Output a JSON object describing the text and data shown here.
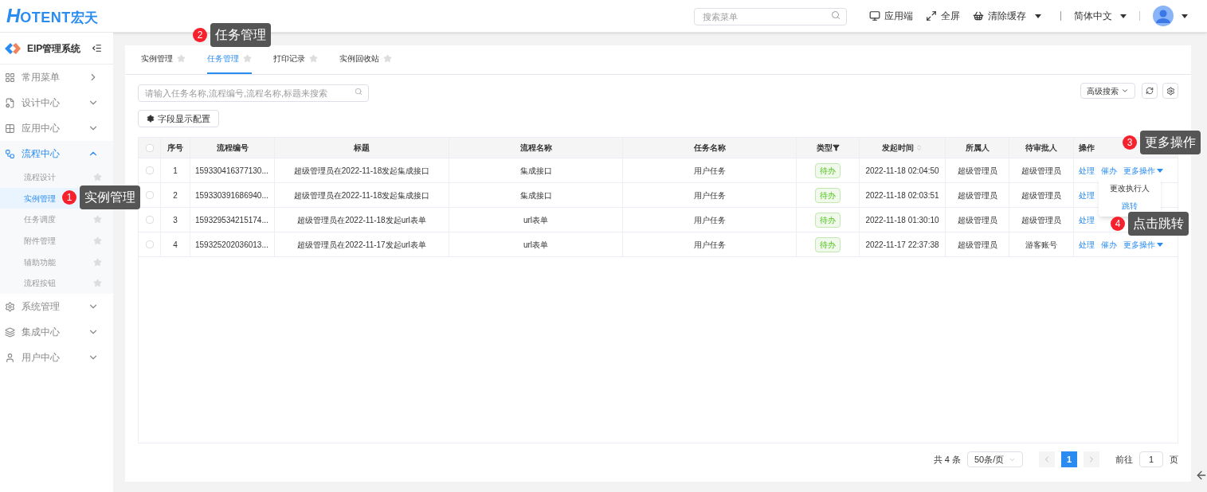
{
  "header": {
    "logo": {
      "mark": "H",
      "text": "OTENT",
      "suffix": "宏天"
    },
    "search": {
      "placeholder": "搜索菜单"
    },
    "tools": [
      {
        "label": "应用端",
        "dropdown": false
      },
      {
        "label": "全屏",
        "dropdown": false
      },
      {
        "label": "清除缓存",
        "dropdown": true
      }
    ],
    "language": {
      "label": "简体中文"
    }
  },
  "sidebar": {
    "title": "EIP管理系统",
    "items": [
      {
        "label": "常用菜单",
        "kind": "link",
        "selected": false
      },
      {
        "label": "设计中心",
        "kind": "group",
        "expanded": false,
        "selected": false
      },
      {
        "label": "应用中心",
        "kind": "group",
        "expanded": false,
        "selected": false
      },
      {
        "label": "流程中心",
        "kind": "group",
        "expanded": true,
        "selected": true,
        "children": [
          {
            "label": "流程设计",
            "selected": false
          },
          {
            "label": "实例管理",
            "selected": true
          },
          {
            "label": "任务调度",
            "selected": false
          },
          {
            "label": "附件管理",
            "selected": false
          },
          {
            "label": "辅助功能",
            "selected": false
          },
          {
            "label": "流程按钮",
            "selected": false
          }
        ]
      },
      {
        "label": "系统管理",
        "kind": "group",
        "expanded": false,
        "selected": false
      },
      {
        "label": "集成中心",
        "kind": "group",
        "expanded": false,
        "selected": false
      },
      {
        "label": "用户中心",
        "kind": "group",
        "expanded": false,
        "selected": false
      }
    ]
  },
  "tabs": [
    {
      "label": "实例管理",
      "selected": false
    },
    {
      "label": "任务管理",
      "selected": true
    },
    {
      "label": "打印记录",
      "selected": false
    },
    {
      "label": "实例回收站",
      "selected": false
    }
  ],
  "toolbar": {
    "search": {
      "placeholder": "请输入任务名称,流程编号,流程名称,标题来搜索"
    },
    "advanced_search": "高级搜索",
    "field_config": "字段显示配置"
  },
  "table": {
    "select_all_checked": false,
    "columns": [
      {
        "label": "序号"
      },
      {
        "label": "流程编号"
      },
      {
        "label": "标题"
      },
      {
        "label": "流程名称"
      },
      {
        "label": "任务名称"
      },
      {
        "label": "类型",
        "filter": true
      },
      {
        "label": "发起时间",
        "sort": true
      },
      {
        "label": "所属人"
      },
      {
        "label": "待审批人"
      },
      {
        "label": "操作"
      }
    ],
    "rows": [
      {
        "checked": false,
        "cells": [
          "1",
          "159330416377130...",
          "超级管理员在2022-11-18发起集成接口",
          "集成接口",
          "用户任务",
          "待办",
          "2022-11-18 02:04:50",
          "超级管理员",
          "超级管理员"
        ],
        "actions": [
          {
            "label": "处理",
            "kind": "link"
          },
          {
            "label": "催办",
            "kind": "link"
          },
          {
            "label": "更多操作",
            "kind": "menu"
          }
        ]
      },
      {
        "checked": false,
        "cells": [
          "2",
          "159330391686940...",
          "超级管理员在2022-11-18发起集成接口",
          "集成接口",
          "用户任务",
          "待办",
          "2022-11-18 02:03:51",
          "超级管理员",
          "超级管理员"
        ],
        "actions": [
          {
            "label": "处理",
            "kind": "link"
          }
        ]
      },
      {
        "checked": false,
        "cells": [
          "3",
          "159329534215174...",
          "超级管理员在2022-11-18发起url表单",
          "url表单",
          "用户任务",
          "待办",
          "2022-11-18 01:30:10",
          "超级管理员",
          "超级管理员"
        ],
        "actions": [
          {
            "label": "处理",
            "kind": "link"
          }
        ]
      },
      {
        "checked": false,
        "cells": [
          "4",
          "159325202036013...",
          "超级管理员在2022-11-17发起url表单",
          "url表单",
          "用户任务",
          "待办",
          "2022-11-17 22:37:38",
          "超级管理员",
          "游客账号"
        ],
        "actions": [
          {
            "label": "处理",
            "kind": "link"
          },
          {
            "label": "催办",
            "kind": "link"
          },
          {
            "label": "更多操作",
            "kind": "menu"
          }
        ]
      }
    ]
  },
  "more_menu": {
    "items": [
      {
        "label": "更改执行人"
      },
      {
        "label": "跳转"
      }
    ]
  },
  "callouts": [
    {
      "number": "1",
      "text": "实例管理"
    },
    {
      "number": "2",
      "text": "任务管理"
    },
    {
      "number": "3",
      "text": "更多操作"
    },
    {
      "number": "4",
      "text": "点击跳转"
    }
  ],
  "pagination": {
    "total": "共 4 条",
    "page_size": "50条/页",
    "pages": [
      {
        "label": "1",
        "selected": true
      }
    ],
    "goto_label": "前往",
    "goto_value": "1",
    "page_suffix": "页"
  }
}
